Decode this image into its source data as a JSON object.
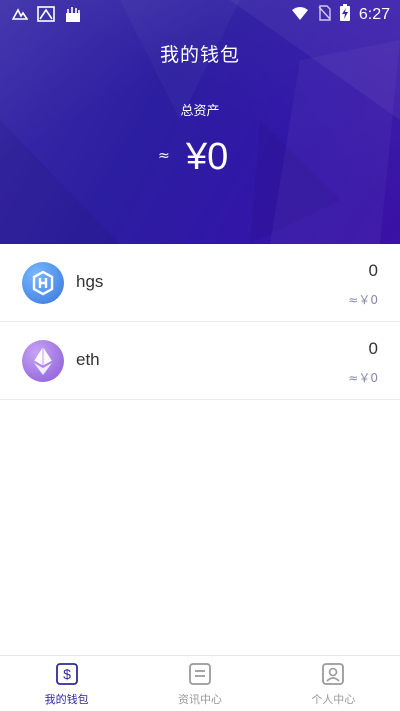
{
  "status_bar": {
    "time": "6:27"
  },
  "header": {
    "title": "我的钱包",
    "total_label": "总资产",
    "approx": "≈",
    "total_amount": "¥0"
  },
  "assets": [
    {
      "name": "hgs",
      "quantity": "0",
      "fiat_value": "≈￥0",
      "logo_color": "#4f8fe8"
    },
    {
      "name": "eth",
      "quantity": "0",
      "fiat_value": "≈￥0",
      "logo_color": "#9a6cde"
    }
  ],
  "tabs": [
    {
      "label": "我的钱包",
      "icon": "wallet-icon",
      "active": true
    },
    {
      "label": "资讯中心",
      "icon": "news-icon",
      "active": false
    },
    {
      "label": "个人中心",
      "icon": "profile-icon",
      "active": false
    }
  ],
  "colors": {
    "header_bg": "#2e1fa0",
    "accent": "#2f2a9e",
    "muted_text": "#9a9a9a"
  }
}
